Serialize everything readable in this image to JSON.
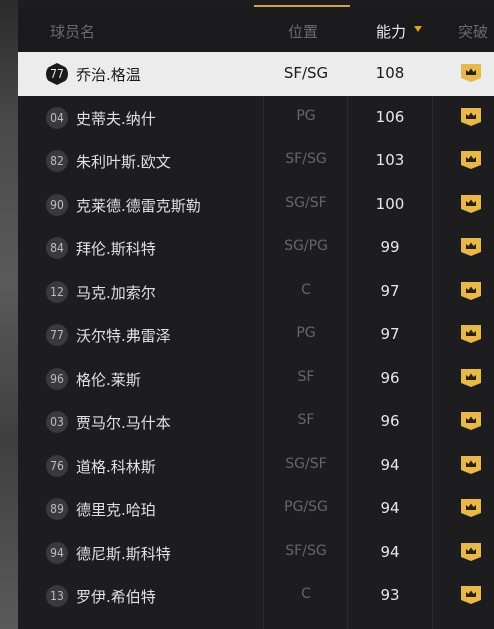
{
  "header": {
    "col_name": "球员名",
    "col_position": "位置",
    "col_rating": "能力",
    "col_breakthrough": "突破"
  },
  "colors": {
    "accent": "#e0a020",
    "badge": "#e8b84a",
    "selected_row": "#ececec"
  },
  "players": [
    {
      "number": "77",
      "name": "乔治.格温",
      "position": "SF/SG",
      "rating": "108",
      "selected": true
    },
    {
      "number": "04",
      "name": "史蒂夫.纳什",
      "position": "PG",
      "rating": "106"
    },
    {
      "number": "82",
      "name": "朱利叶斯.欧文",
      "position": "SF/SG",
      "rating": "103"
    },
    {
      "number": "90",
      "name": "克莱德.德雷克斯勒",
      "position": "SG/SF",
      "rating": "100"
    },
    {
      "number": "84",
      "name": "拜伦.斯科特",
      "position": "SG/PG",
      "rating": "99"
    },
    {
      "number": "12",
      "name": "马克.加索尔",
      "position": "C",
      "rating": "97"
    },
    {
      "number": "77",
      "name": "沃尔特.弗雷泽",
      "position": "PG",
      "rating": "97"
    },
    {
      "number": "96",
      "name": "格伦.莱斯",
      "position": "SF",
      "rating": "96"
    },
    {
      "number": "03",
      "name": "贾马尔.马什本",
      "position": "SF",
      "rating": "96"
    },
    {
      "number": "76",
      "name": "道格.科林斯",
      "position": "SG/SF",
      "rating": "94"
    },
    {
      "number": "89",
      "name": "德里克.哈珀",
      "position": "PG/SG",
      "rating": "94"
    },
    {
      "number": "94",
      "name": "德尼斯.斯科特",
      "position": "SF/SG",
      "rating": "94"
    },
    {
      "number": "13",
      "name": "罗伊.希伯特",
      "position": "C",
      "rating": "93"
    }
  ]
}
